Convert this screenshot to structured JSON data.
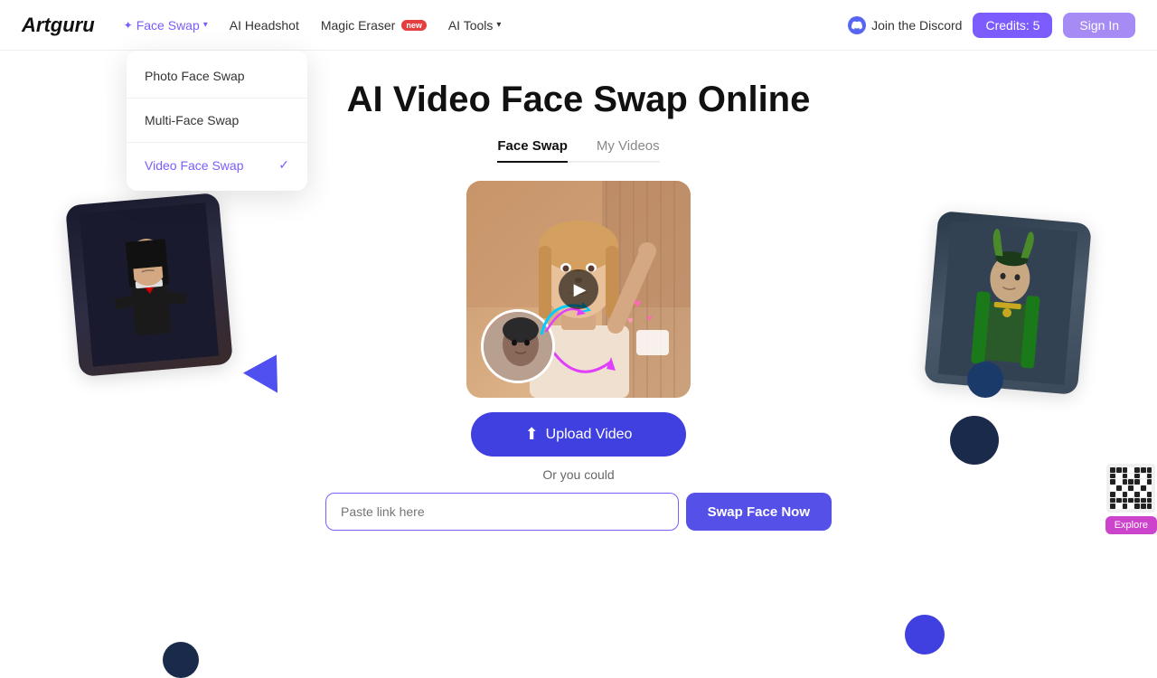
{
  "logo": {
    "text": "Artguru"
  },
  "navbar": {
    "face_swap_label": "Face Swap",
    "ai_headshot_label": "AI Headshot",
    "magic_eraser_label": "Magic Eraser",
    "ai_tools_label": "AI Tools",
    "new_badge": "new",
    "discord_label": "Join the Discord",
    "credits_label": "Credits: 5",
    "signin_label": "Sign In"
  },
  "dropdown": {
    "items": [
      {
        "label": "Photo Face Swap",
        "active": false
      },
      {
        "label": "Multi-Face Swap",
        "active": false
      },
      {
        "label": "Video Face Swap",
        "active": true
      }
    ]
  },
  "main": {
    "title": "AI Video Face Swap Online",
    "tabs": [
      {
        "label": "Face Swap",
        "active": true
      },
      {
        "label": "My Videos",
        "active": false
      }
    ],
    "upload_btn": "Upload Video",
    "or_text": "Or you could",
    "paste_placeholder": "Paste link here",
    "swap_btn": "Swap Face Now"
  },
  "decorations": {
    "explore_label": "Explore"
  }
}
